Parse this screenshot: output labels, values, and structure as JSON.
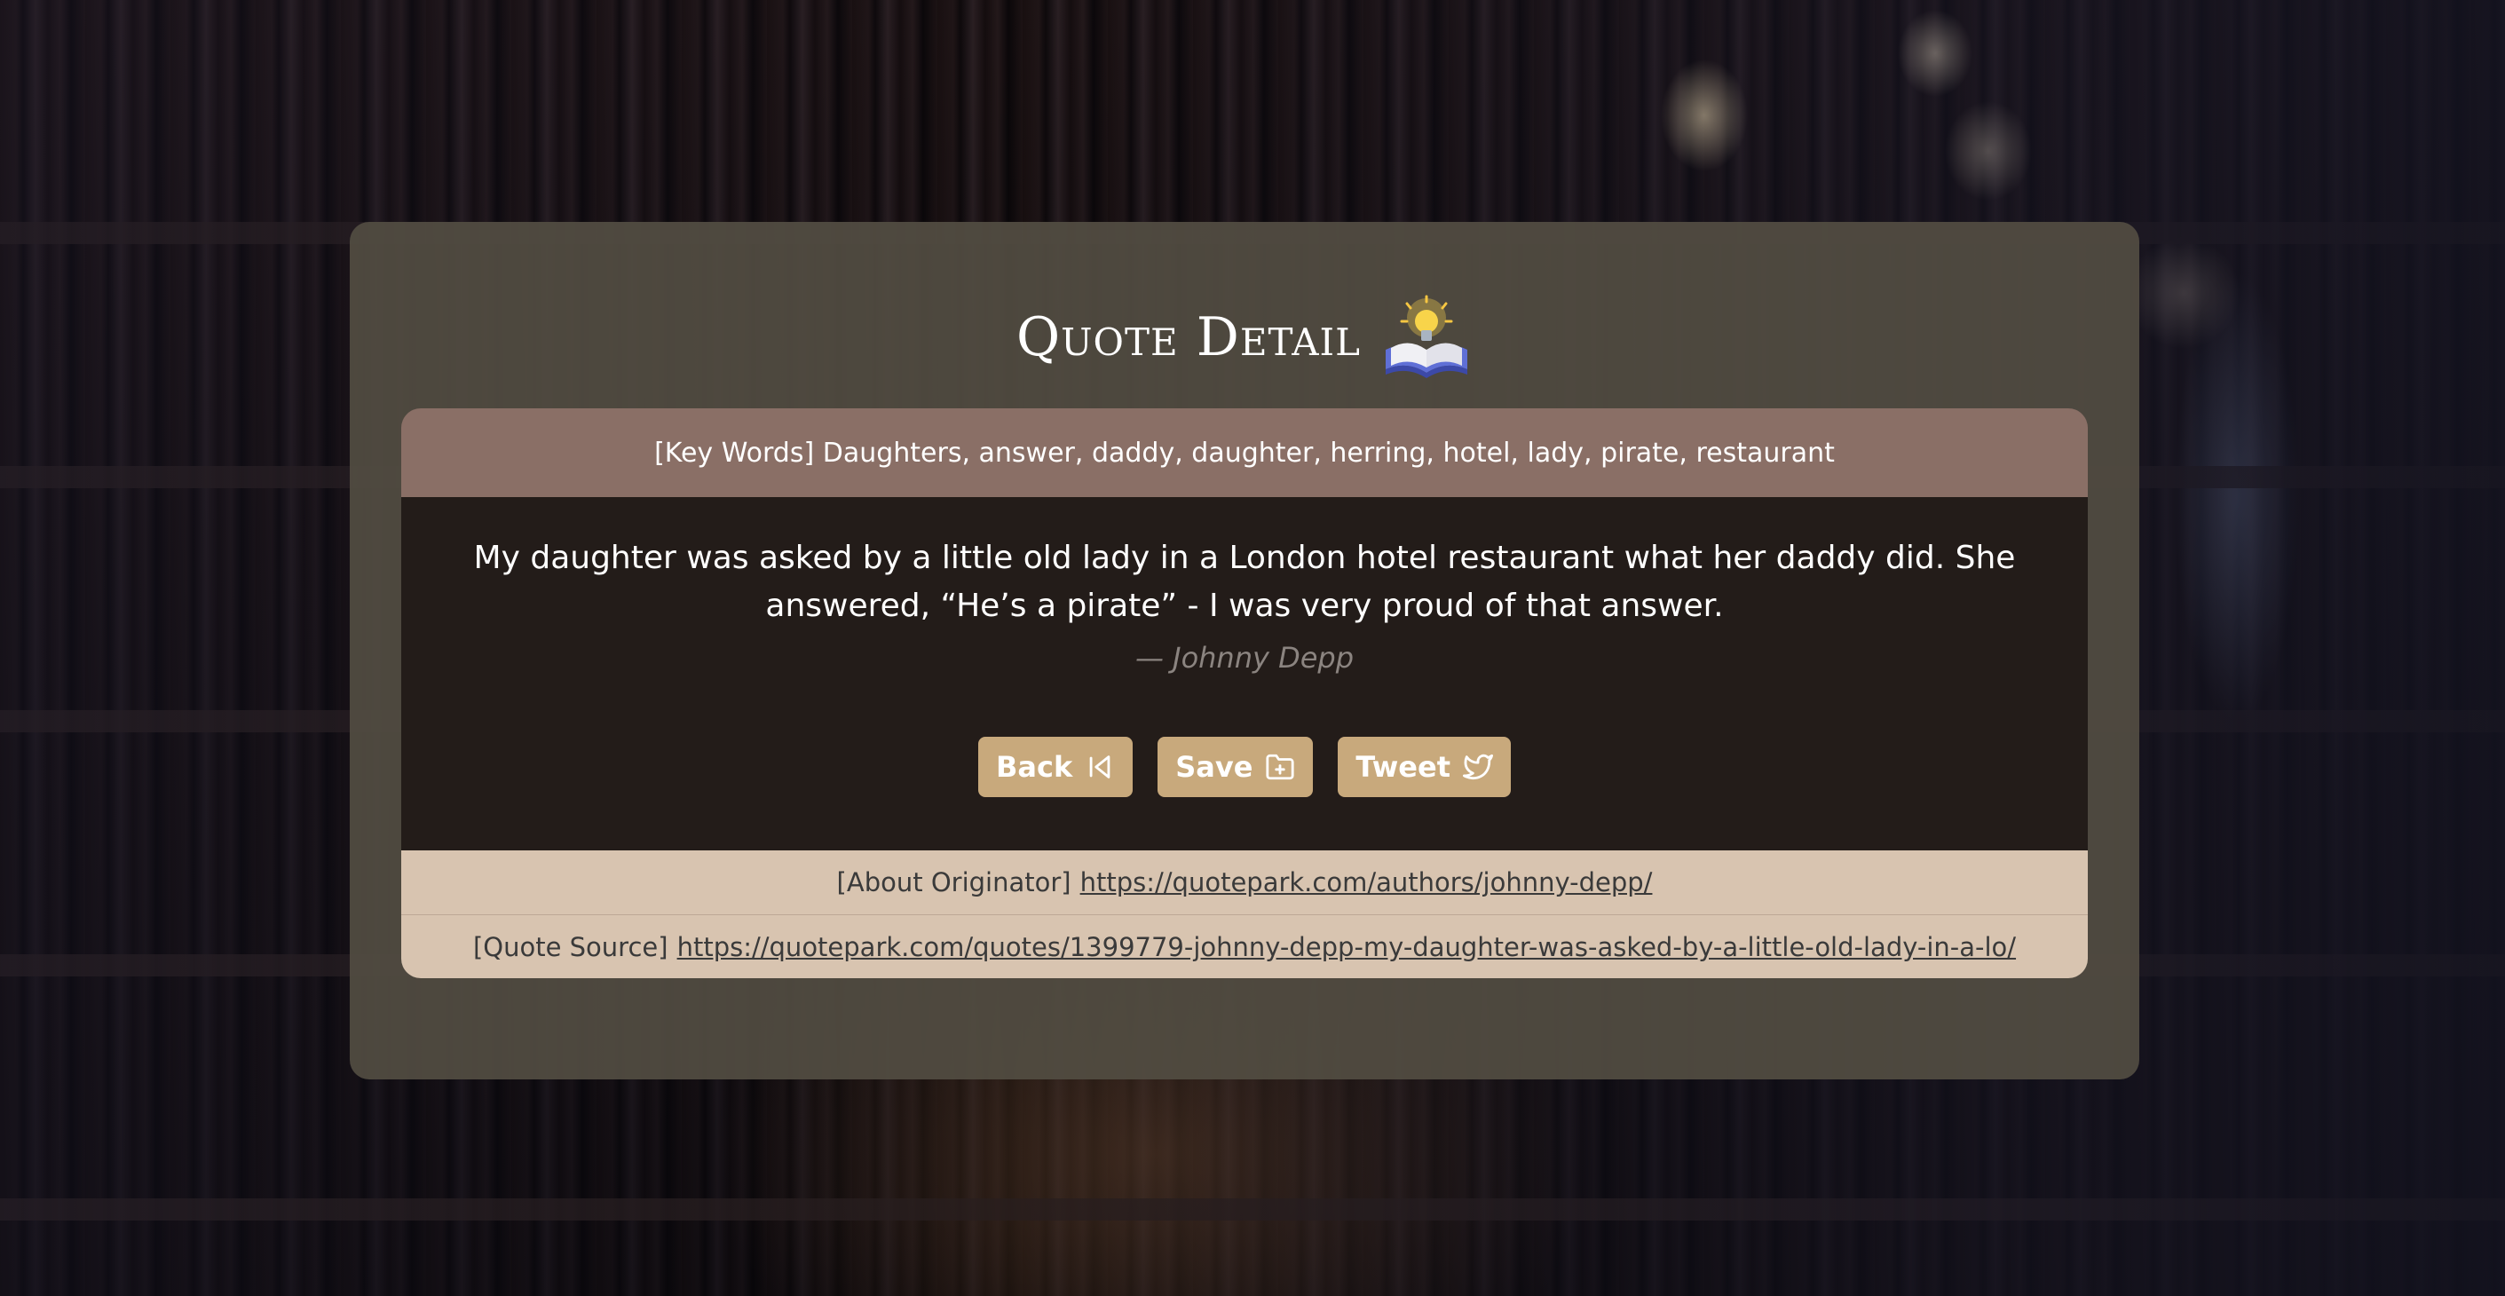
{
  "page": {
    "title": "Quote Detail",
    "title_icon": "book-lightbulb-icon"
  },
  "keywords": {
    "label": "[Key Words]",
    "text": "Daughters, answer, daddy, daughter, herring, hotel, lady, pirate, restaurant"
  },
  "quote": {
    "text": "My daughter was asked by a little old lady in a London hotel restaurant what her daddy did. She answered, “He’s a pirate” - I was very proud of that answer.",
    "author": "— Johnny Depp"
  },
  "buttons": {
    "back": {
      "label": "Back",
      "icon": "skip-back-icon"
    },
    "save": {
      "label": "Save",
      "icon": "folder-plus-icon"
    },
    "tweet": {
      "label": "Tweet",
      "icon": "twitter-bird-icon"
    }
  },
  "originator": {
    "label": "[About Originator]",
    "url": "https://quotepark.com/authors/johnny-depp/"
  },
  "source": {
    "label": "[Quote Source]",
    "url": "https://quotepark.com/quotes/1399779-johnny-depp-my-daughter-was-asked-by-a-little-old-lady-in-a-lo/"
  },
  "colors": {
    "card": "#524c42",
    "keyword_bar": "#8a6f66",
    "quote_body": "#231c19",
    "button": "#c8a97c",
    "info_rows": "#d8c4b0"
  }
}
